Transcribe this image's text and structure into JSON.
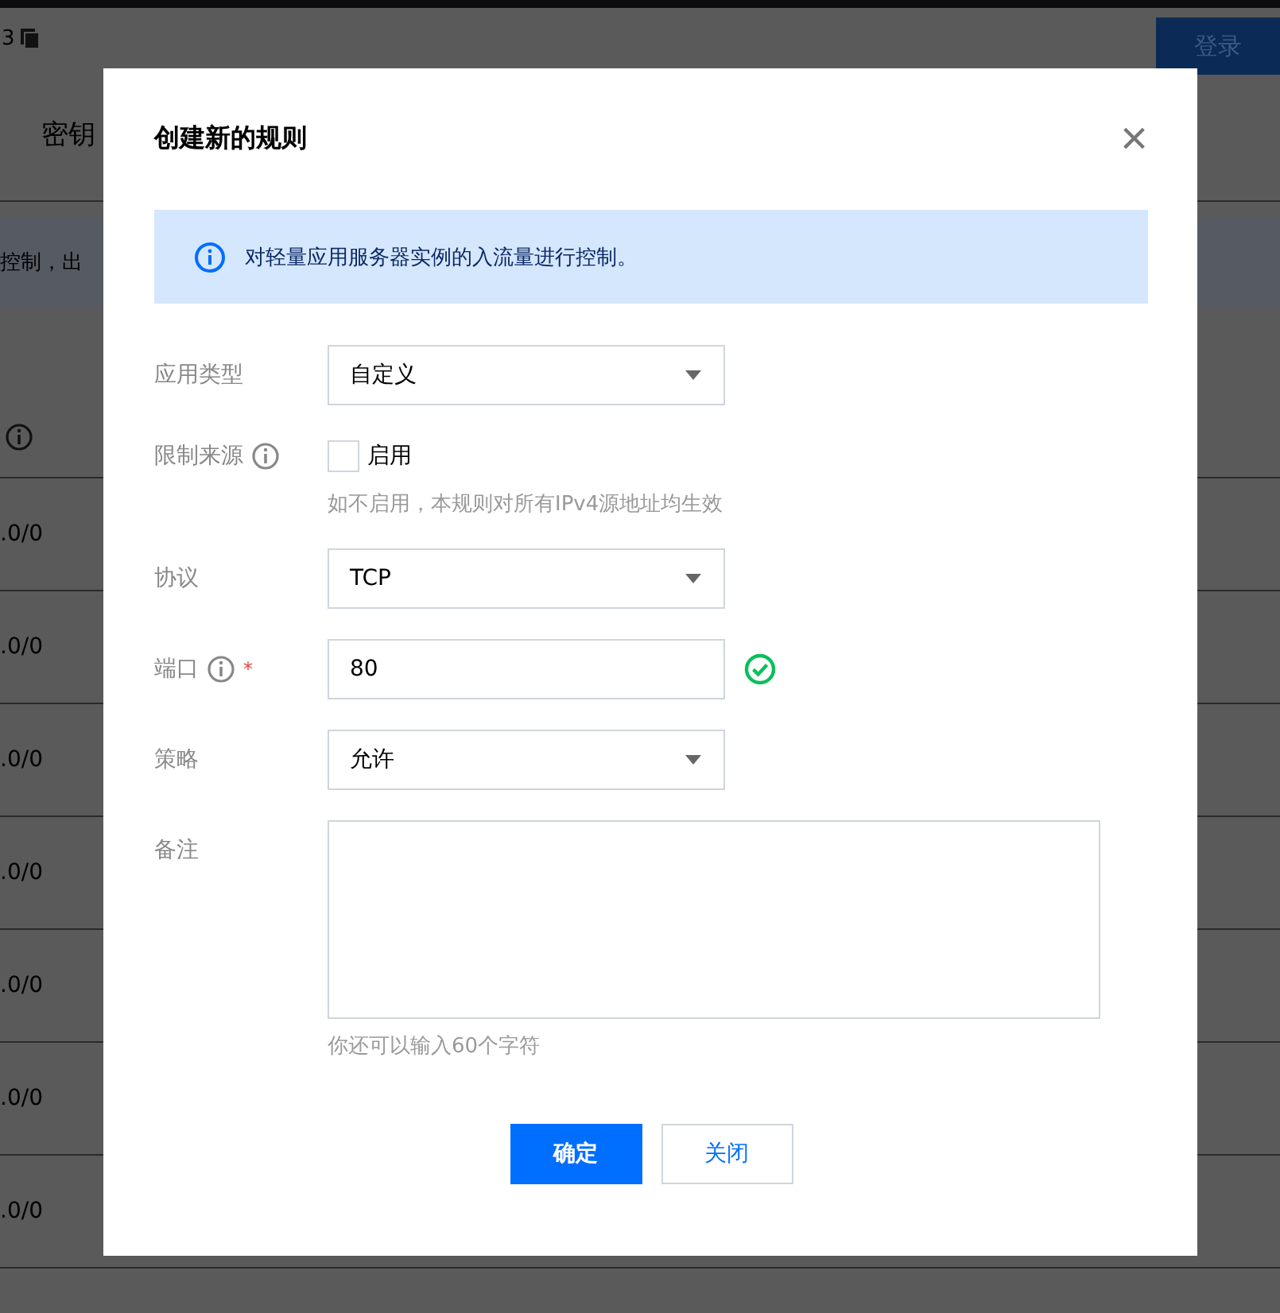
{
  "background": {
    "id_text": "3",
    "login_button": "登录",
    "heading": "密钥",
    "notice": "控制，出",
    "table_cells": [
      ".0/0",
      ".0/0",
      ".0/0",
      ".0/0",
      ".0/0",
      ".0/0",
      ".0/0"
    ]
  },
  "dialog": {
    "title": "创建新的规则",
    "close": "×",
    "info": "对轻量应用服务器实例的入流量进行控制。",
    "fields": [
      {
        "kind": "select",
        "label": "应用类型",
        "value": "自定义"
      },
      {
        "kind": "checkbox",
        "label": "限制来源",
        "help_icon": true,
        "option": "启用",
        "checked": false,
        "hint": "如不启用，本规则对所有IPv4源地址均生效"
      },
      {
        "kind": "select",
        "label": "协议",
        "value": "TCP"
      },
      {
        "kind": "input",
        "label": "端口",
        "help_icon": true,
        "required": "*",
        "value": "80",
        "valid": true
      },
      {
        "kind": "select",
        "label": "策略",
        "value": "允许"
      },
      {
        "kind": "textarea",
        "label": "备注",
        "hint": "你还可以输入60个字符"
      }
    ],
    "buttons": [
      {
        "label": "确定",
        "primary": true
      },
      {
        "label": "关闭",
        "primary": false
      }
    ]
  }
}
